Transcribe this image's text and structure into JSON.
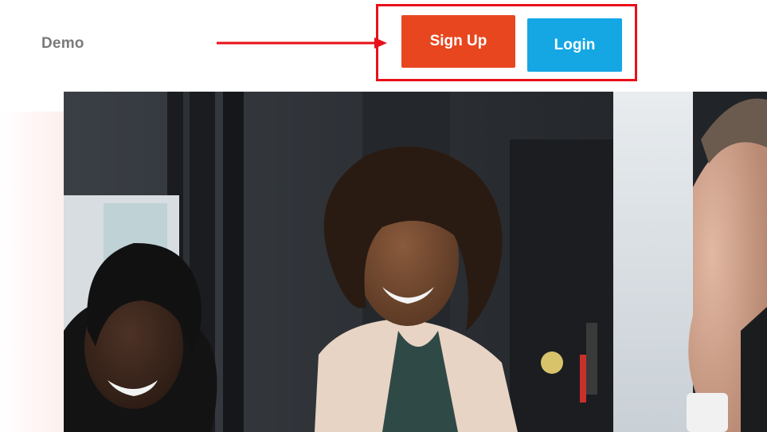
{
  "header": {
    "nav_demo_label": "Demo",
    "signup_label": "Sign Up",
    "login_label": "Login"
  },
  "colors": {
    "signup_button": "#e8461f",
    "login_button": "#14a7e4",
    "annotation_red": "#e8101a",
    "nav_text": "#7a7a7a"
  },
  "hero": {
    "icon": "hero-photo-people-smiling"
  }
}
